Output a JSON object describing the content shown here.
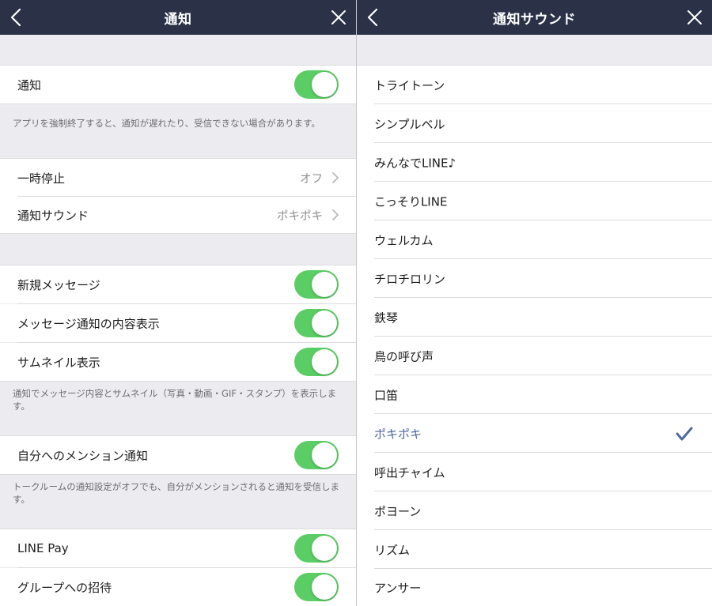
{
  "left": {
    "title": "通知",
    "notification": {
      "label": "通知",
      "on": true
    },
    "notes": {
      "force_quit": "アプリを強制終了すると、通知が遅れたり、受信できない場合があります。",
      "thumbnail": "通知でメッセージ内容とサムネイル（写真・動画・GIF・スタンプ）を表示します。",
      "mention": "トークルームの通知設定がオフでも、自分がメンションされると通知を受信します。"
    },
    "pause": {
      "label": "一時停止",
      "value": "オフ"
    },
    "sound": {
      "label": "通知サウンド",
      "value": "ポキポキ"
    },
    "new_message": {
      "label": "新規メッセージ",
      "on": true
    },
    "message_content": {
      "label": "メッセージ通知の内容表示",
      "on": true
    },
    "thumbnail": {
      "label": "サムネイル表示",
      "on": true
    },
    "mention": {
      "label": "自分へのメンション通知",
      "on": true
    },
    "line_pay": {
      "label": "LINE Pay",
      "on": true
    },
    "group_invite": {
      "label": "グループへの招待",
      "on": true
    }
  },
  "right": {
    "title": "通知サウンド",
    "sounds": [
      {
        "label": "トライトーン"
      },
      {
        "label": "シンプルベル"
      },
      {
        "label": "みんなでLINE♪"
      },
      {
        "label": "こっそりLINE"
      },
      {
        "label": "ウェルカム"
      },
      {
        "label": "チロチロリン"
      },
      {
        "label": "鉄琴"
      },
      {
        "label": "鳥の呼び声"
      },
      {
        "label": "口笛"
      },
      {
        "label": "ポキポキ",
        "selected": true
      },
      {
        "label": "呼出チャイム"
      },
      {
        "label": "ポヨーン"
      },
      {
        "label": "リズム"
      },
      {
        "label": "アンサー"
      }
    ]
  },
  "colors": {
    "navbar": "#2b3248",
    "toggle_on": "#5ace64",
    "selected_text": "#4d6a9f",
    "background": "#ececf0"
  }
}
